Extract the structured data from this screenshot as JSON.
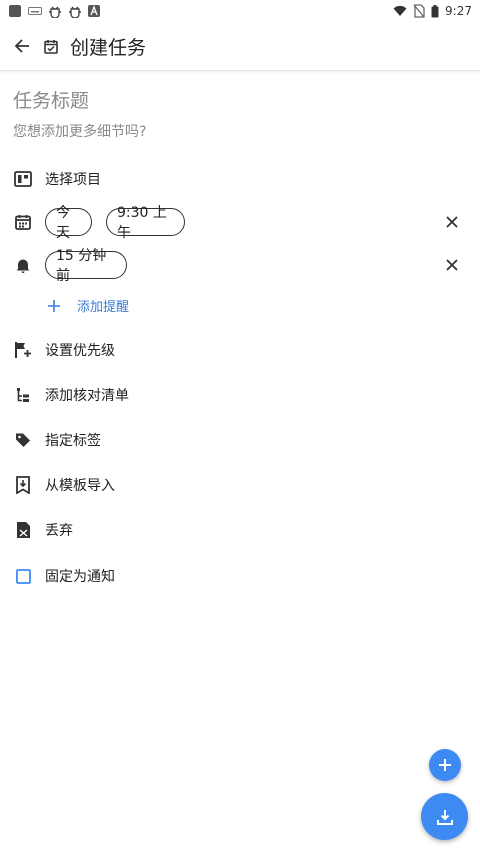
{
  "status_bar": {
    "time": "9:27"
  },
  "app_bar": {
    "title": "创建任务"
  },
  "task": {
    "title_placeholder": "任务标题",
    "description_placeholder": "您想添加更多细节吗?"
  },
  "project": {
    "label": "选择项目"
  },
  "due": {
    "date_chip": "今天",
    "time_chip": "9:30 上午"
  },
  "reminder": {
    "chip": "15 分钟前",
    "add_label": "添加提醒"
  },
  "actions": {
    "priority": "设置优先级",
    "checklist": "添加核对清单",
    "tags": "指定标签",
    "template": "从模板导入",
    "discard": "丢弃",
    "pin": "固定为通知"
  },
  "colors": {
    "accent": "#3d8bf2",
    "link": "#3a7bd5"
  },
  "icons": {
    "back": "arrow-left-icon",
    "calendar": "calendar-check-icon",
    "project": "board-icon",
    "date": "calendar-icon",
    "reminder": "bell-icon",
    "priority": "flag-plus-icon",
    "checklist": "checklist-icon",
    "tag": "tag-icon",
    "template": "import-template-icon",
    "discard": "file-discard-icon",
    "pin": "checkbox-icon",
    "fab_add": "plus-icon",
    "fab_save": "download-icon"
  }
}
